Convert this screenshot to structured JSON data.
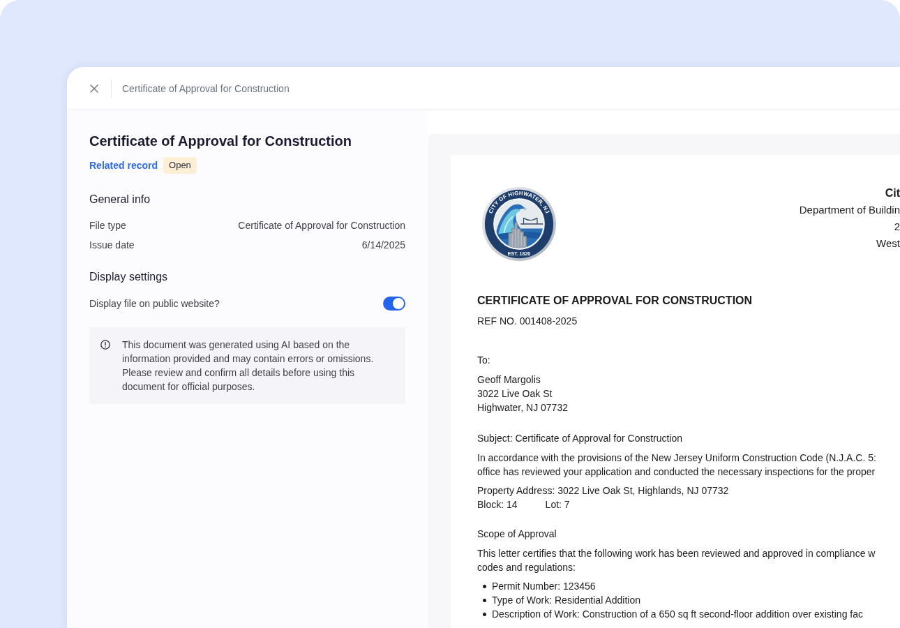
{
  "header": {
    "title": "Certificate of Approval for Construction"
  },
  "details": {
    "title": "Certificate of Approval for Construction",
    "related_link": "Related record",
    "status_badge": "Open"
  },
  "general_info": {
    "heading": "General info",
    "rows": [
      {
        "label": "File type",
        "value": "Certificate of Approval for Construction"
      },
      {
        "label": "Issue date",
        "value": "6/14/2025"
      }
    ]
  },
  "display_settings": {
    "heading": "Display settings",
    "toggle": {
      "label": "Display file on public website?",
      "on": true
    }
  },
  "notice": {
    "text": "This document was generated using AI based on the information provided and may contain errors or omissions. Please review and confirm all details before using this document for official purposes."
  },
  "document": {
    "seal": {
      "top_text": "CITY OF HIGHWATER, NJ",
      "bottom_text": "EST. 1820"
    },
    "letterhead": [
      "Cit",
      "Department of Buildin",
      "2",
      "West"
    ],
    "title": "CERTIFICATE OF APPROVAL FOR CONSTRUCTION",
    "ref": "REF NO. 001408-2025",
    "to_label": "To:",
    "recipient": [
      "Geoff Margolis",
      "3022 Live Oak St",
      "Highwater, NJ 07732"
    ],
    "subject": "Subject: Certificate of Approval for Construction",
    "intro_lines": [
      "In accordance with the provisions of the New Jersey Uniform Construction Code (N.J.A.C. 5:",
      "office has reviewed your application and conducted the necessary inspections for the proper"
    ],
    "property_address": "Property Address: 3022 Live Oak St, Highlands, NJ 07732",
    "block": "Block: 14",
    "lot": "Lot: 7",
    "scope_heading": "Scope of Approval",
    "scope_lines": [
      "This letter certifies that the following work has been reviewed and approved in compliance w",
      "codes and regulations:"
    ],
    "scope_items": [
      "Permit Number: 123456",
      "Type of Work: Residential Addition",
      "Description of Work: Construction of a 650 sq ft second-floor addition over existing fac"
    ]
  }
}
